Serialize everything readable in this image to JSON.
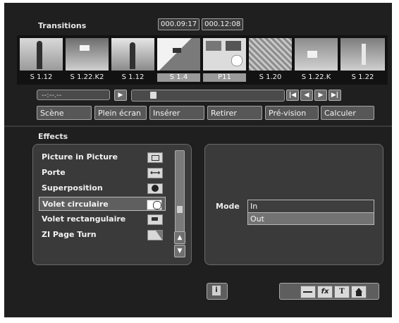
{
  "transitions": {
    "title": "Transitions",
    "timecodes": [
      "000.09:17",
      "000.12:08"
    ],
    "clips": [
      {
        "label": "S 1.12",
        "selected": false
      },
      {
        "label": "S 1.22.K2",
        "selected": false
      },
      {
        "label": "S 1.12",
        "selected": false
      },
      {
        "label": "S 1.4",
        "selected": true
      },
      {
        "label": "P11",
        "selected": true
      },
      {
        "label": "S 1.20",
        "selected": false
      },
      {
        "label": "S 1.22.K",
        "selected": false
      },
      {
        "label": "S 1.22",
        "selected": false
      }
    ],
    "time_field": "--:--.--"
  },
  "toolbar": {
    "scene": "Scène",
    "fullscreen": "Plein écran",
    "insert": "Insérer",
    "remove": "Retirer",
    "preview": "Pré-vision",
    "calculate": "Calculer"
  },
  "effects": {
    "title": "Effects",
    "items": [
      {
        "label": "Picture in Picture",
        "icon": "picture-in-picture-icon",
        "selected": false
      },
      {
        "label": "Porte",
        "icon": "door-icon",
        "selected": false
      },
      {
        "label": "Superposition",
        "icon": "superposition-icon",
        "selected": false
      },
      {
        "label": "Volet circulaire",
        "icon": "circular-wipe-icon",
        "selected": true
      },
      {
        "label": "Volet rectangulaire",
        "icon": "rectangular-wipe-icon",
        "selected": false
      },
      {
        "label": "ZI Page Turn",
        "icon": "page-turn-icon",
        "selected": false
      }
    ]
  },
  "mode": {
    "label": "Mode",
    "options": [
      {
        "label": "In",
        "selected": false
      },
      {
        "label": "Out",
        "selected": true
      }
    ]
  },
  "footer": {
    "info_glyph": "i",
    "tools": [
      "edit-tool-icon",
      "fx-icon",
      "text-icon",
      "home-icon"
    ],
    "fx_glyph": "fx",
    "text_glyph": "T"
  }
}
